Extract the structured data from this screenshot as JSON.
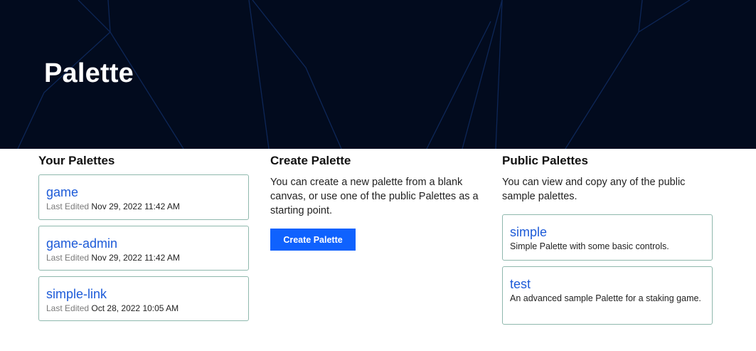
{
  "header": {
    "title": "Palette"
  },
  "your_palettes": {
    "heading": "Your Palettes",
    "items": [
      {
        "name": "game",
        "last_edited_label": "Last Edited",
        "last_edited": "Nov 29, 2022 11:42 AM"
      },
      {
        "name": "game-admin",
        "last_edited_label": "Last Edited",
        "last_edited": "Nov 29, 2022 11:42 AM"
      },
      {
        "name": "simple-link",
        "last_edited_label": "Last Edited",
        "last_edited": "Oct 28, 2022 10:05 AM"
      }
    ]
  },
  "create_palette": {
    "heading": "Create Palette",
    "description": "You can create a new palette from a blank canvas, or use one of the public Palettes as a starting point.",
    "button_label": "Create Palette"
  },
  "public_palettes": {
    "heading": "Public Palettes",
    "description": "You can view and copy any of the public sample palettes.",
    "items": [
      {
        "name": "simple",
        "description": "Simple Palette with some basic controls."
      },
      {
        "name": "test",
        "description": "An advanced sample Palette for a staking game."
      }
    ]
  },
  "colors": {
    "hero_bg": "#020b1e",
    "accent": "#0f62fe",
    "link": "#1d5bd8",
    "card_border": "#8fb8ad"
  }
}
